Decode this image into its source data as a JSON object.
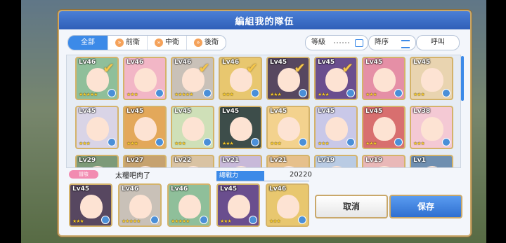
{
  "dialog": {
    "title": "編組我的隊伍"
  },
  "tabs": [
    {
      "label": "全部",
      "active": true
    },
    {
      "label": "前衛",
      "active": false
    },
    {
      "label": "中衛",
      "active": false
    },
    {
      "label": "後衛",
      "active": false
    }
  ],
  "sort": {
    "field_label": "等級",
    "order_label": "降序",
    "call_label": "呼叫"
  },
  "roster": [
    {
      "level": "Lv46",
      "stars": "★★★★★",
      "selected": true,
      "color": "#8fbf9a"
    },
    {
      "level": "Lv46",
      "stars": "★★★",
      "selected": false,
      "color": "#f2b6c6"
    },
    {
      "level": "Lv46",
      "stars": "★★★★★",
      "selected": true,
      "color": "#c9c1b8"
    },
    {
      "level": "Lv46",
      "stars": "★★★",
      "selected": true,
      "color": "#e8c76f"
    },
    {
      "level": "Lv45",
      "stars": "★★★",
      "selected": true,
      "color": "#574760"
    },
    {
      "level": "Lv45",
      "stars": "★★★",
      "selected": true,
      "color": "#6a4e8e"
    },
    {
      "level": "Lv45",
      "stars": "★★★",
      "selected": false,
      "color": "#e58fa6"
    },
    {
      "level": "Lv45",
      "stars": "★★★",
      "selected": false,
      "color": "#e9d4b0"
    },
    {
      "level": "Lv45",
      "stars": "★★★",
      "selected": false,
      "color": "#d9d4e6"
    },
    {
      "level": "Lv45",
      "stars": "★★★",
      "selected": false,
      "color": "#e3a85a"
    },
    {
      "level": "Lv45",
      "stars": "★★★",
      "selected": false,
      "color": "#cfe0b8"
    },
    {
      "level": "Lv45",
      "stars": "★★★",
      "selected": false,
      "color": "#3d4d4a"
    },
    {
      "level": "Lv45",
      "stars": "★★★",
      "selected": false,
      "color": "#f3d28e"
    },
    {
      "level": "Lv45",
      "stars": "★★★",
      "selected": false,
      "color": "#c9c8e8"
    },
    {
      "level": "Lv45",
      "stars": "★★★",
      "selected": false,
      "color": "#d86f6f"
    },
    {
      "level": "Lv38",
      "stars": "★★★",
      "selected": false,
      "color": "#f4c9d4"
    },
    {
      "level": "Lv29",
      "stars": "",
      "selected": false,
      "color": "#7d9a78"
    },
    {
      "level": "Lv27",
      "stars": "",
      "selected": false,
      "color": "#c6a26f"
    },
    {
      "level": "Lv22",
      "stars": "",
      "selected": false,
      "color": "#d9c3a3"
    },
    {
      "level": "Lv21",
      "stars": "",
      "selected": false,
      "color": "#c8b9d9"
    },
    {
      "level": "Lv21",
      "stars": "",
      "selected": false,
      "color": "#e6c08c"
    },
    {
      "level": "Lv19",
      "stars": "",
      "selected": false,
      "color": "#b9cbe3"
    },
    {
      "level": "Lv19",
      "stars": "",
      "selected": false,
      "color": "#e9b8b8"
    },
    {
      "level": "Lv1",
      "stars": "",
      "selected": false,
      "color": "#6f8fb0"
    }
  ],
  "team": {
    "name_label": "冒險",
    "name": "太糧吧肉了",
    "power_label": "總戰力",
    "power_value": "20220",
    "members": [
      {
        "level": "Lv45",
        "stars": "★★★",
        "color": "#574760"
      },
      {
        "level": "Lv46",
        "stars": "★★★★★",
        "color": "#c9c1b8"
      },
      {
        "level": "Lv46",
        "stars": "★★★★★",
        "color": "#8fbf9a"
      },
      {
        "level": "Lv45",
        "stars": "★★★",
        "color": "#6a4e8e"
      },
      {
        "level": "Lv46",
        "stars": "★★★",
        "color": "#e8c76f"
      }
    ]
  },
  "actions": {
    "cancel_label": "取消",
    "save_label": "保存"
  }
}
